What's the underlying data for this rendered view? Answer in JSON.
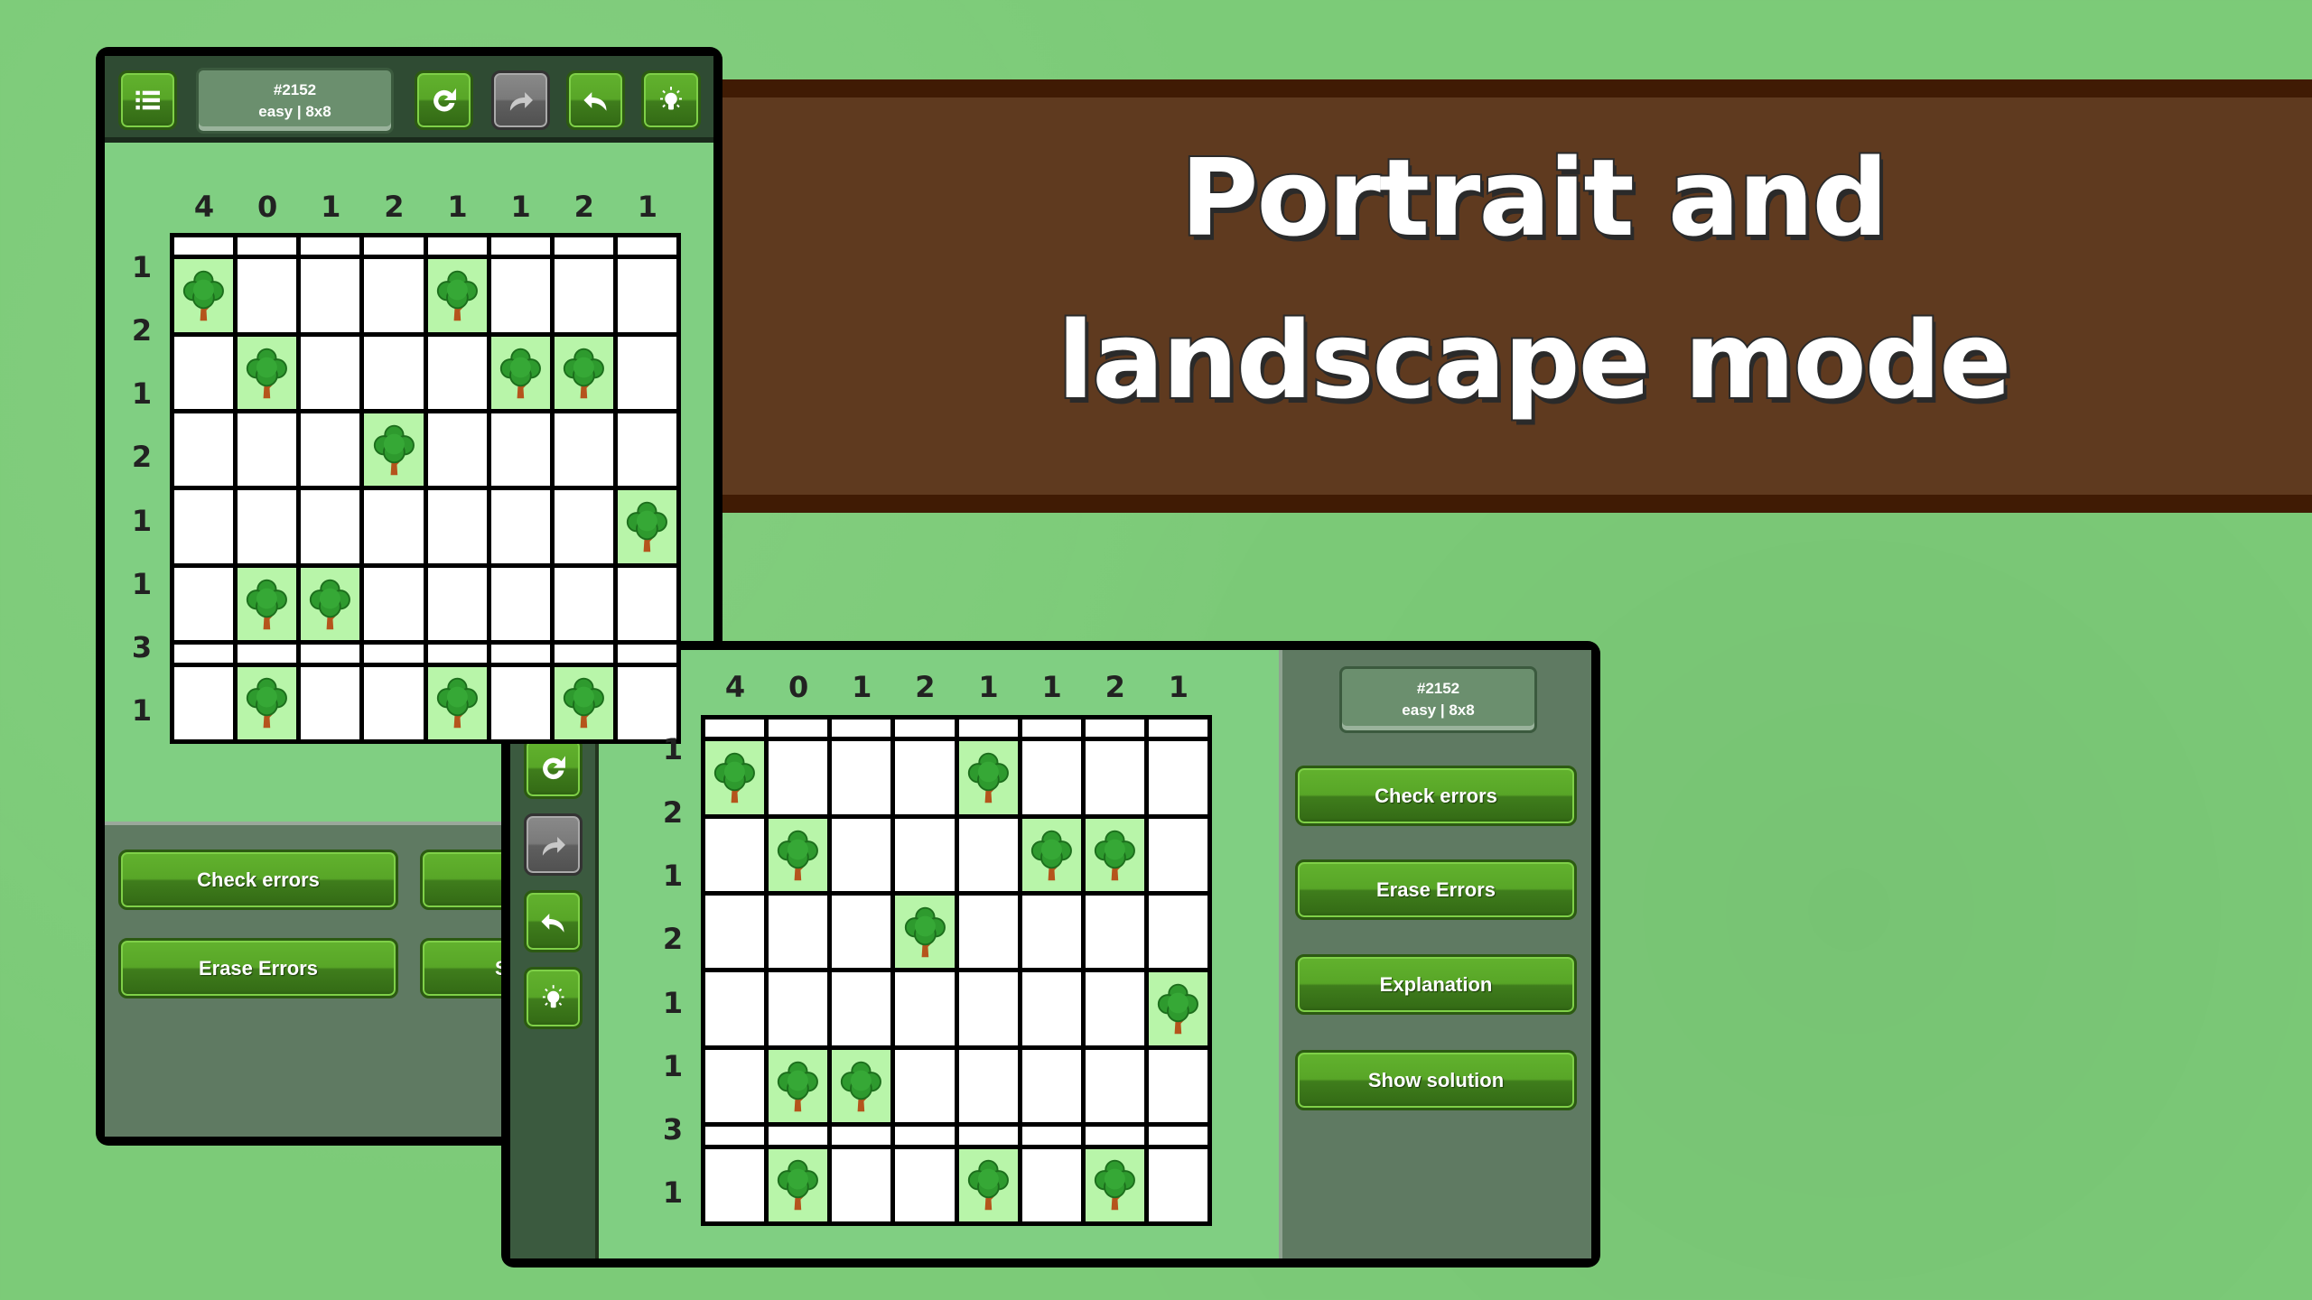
{
  "headline": {
    "line1": "Portrait and",
    "line2": "landscape mode"
  },
  "colors": {
    "background": "#7ccb78",
    "banner": "#5f3a1f",
    "button": "#58a627",
    "tree_cell": "#b8f5a9"
  },
  "puzzle": {
    "id": "#2152",
    "meta": "easy | 8x8",
    "col_clues": [
      "4",
      "0",
      "1",
      "2",
      "1",
      "1",
      "2",
      "1"
    ],
    "row_clues": [
      "1",
      "2",
      "1",
      "2",
      "1",
      "1",
      "3",
      "1"
    ],
    "trees": [
      [],
      [
        0,
        4
      ],
      [
        1,
        5,
        6
      ],
      [
        3
      ],
      [
        7
      ],
      [
        1,
        2
      ],
      [],
      [
        1,
        4,
        6
      ]
    ]
  },
  "toolbar": {
    "icons": [
      "menu-icon",
      "refresh-icon",
      "redo-icon",
      "undo-icon",
      "hint-bulb-icon"
    ],
    "redo_disabled": true
  },
  "portrait": {
    "buttons_left": [
      "Check errors",
      "Erase Errors"
    ],
    "buttons_right": [
      "",
      "Show solution"
    ]
  },
  "landscape": {
    "buttons": [
      "Check errors",
      "Erase Errors",
      "Explanation",
      "Show solution"
    ]
  }
}
